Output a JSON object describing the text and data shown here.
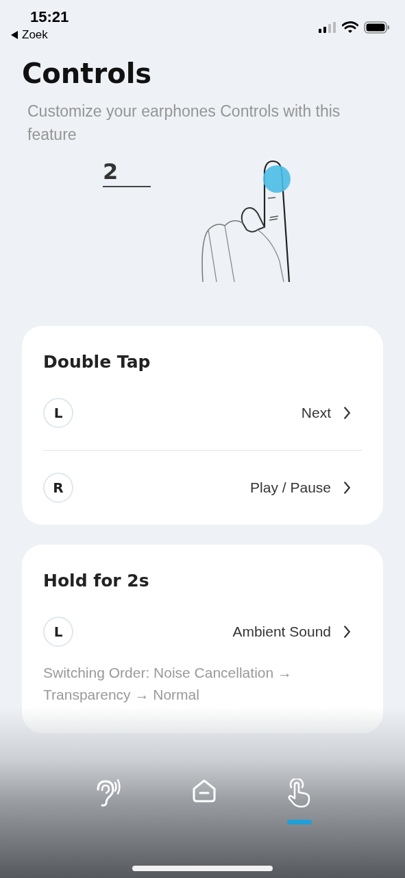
{
  "status_bar": {
    "time": "15:21",
    "back_label": "Zoek"
  },
  "header": {
    "title": "Controls",
    "subtitle": "Customize your earphones  Controls with this feature"
  },
  "illustration": {
    "tap_count": "2"
  },
  "sections": [
    {
      "title": "Double Tap",
      "rows": [
        {
          "side": "L",
          "value": "Next"
        },
        {
          "side": "R",
          "value": "Play / Pause"
        }
      ]
    },
    {
      "title": "Hold for 2s",
      "rows": [
        {
          "side": "L",
          "value": "Ambient Sound",
          "note": "Switching Order: Noise Cancellation → Transparency → Normal"
        }
      ]
    }
  ],
  "tab_bar": {
    "tabs": [
      {
        "kind": "ear",
        "selected": false
      },
      {
        "kind": "home",
        "selected": false
      },
      {
        "kind": "touch",
        "selected": true
      }
    ]
  }
}
